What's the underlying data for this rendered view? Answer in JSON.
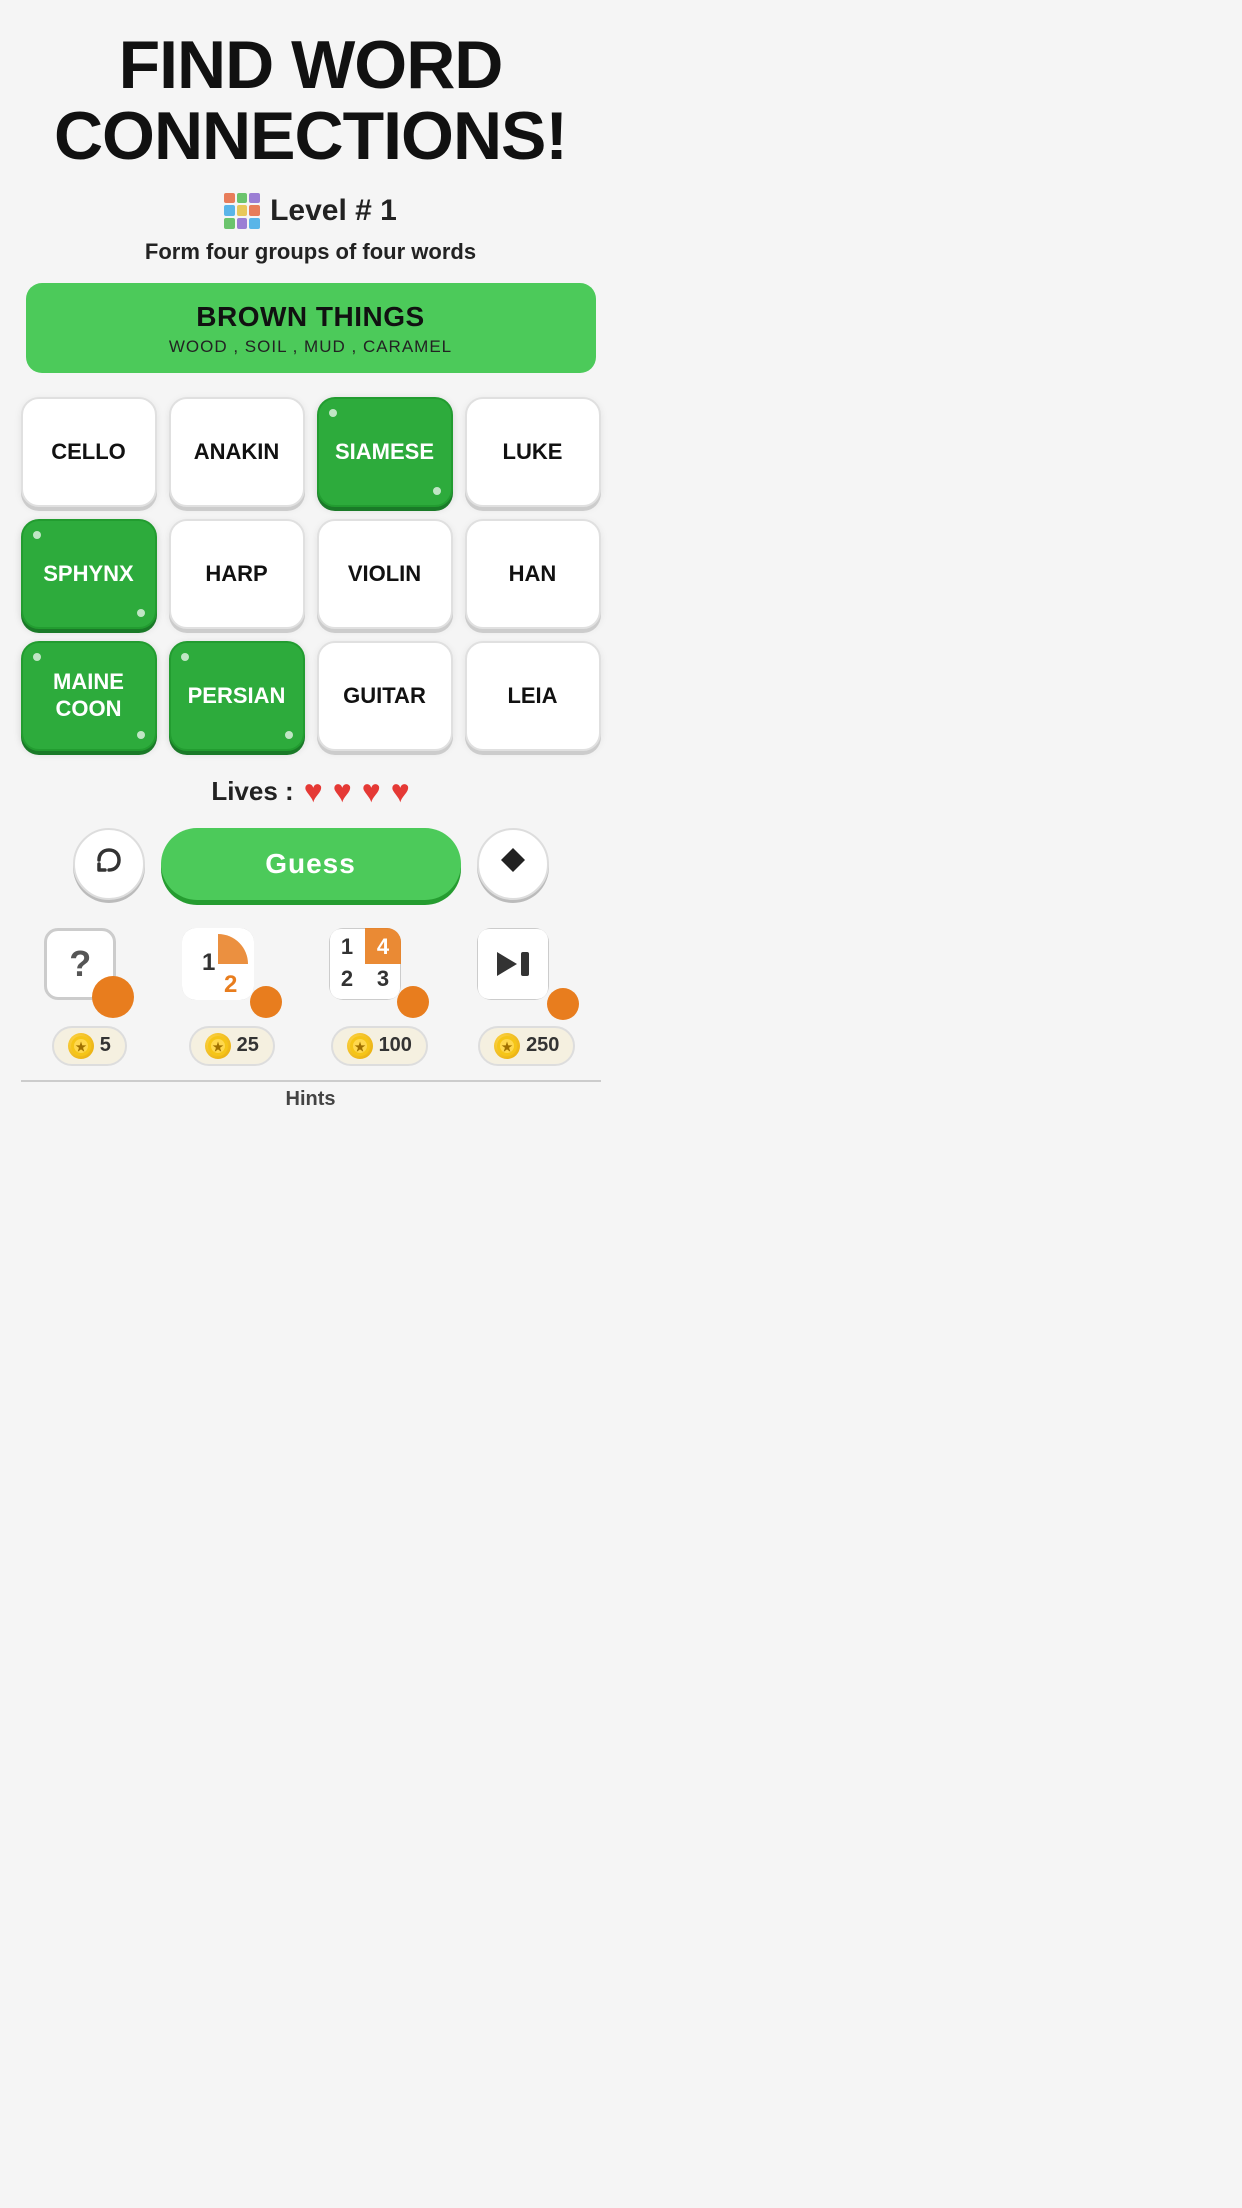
{
  "title": "FIND WORD CONNECTIONS!",
  "level": {
    "label": "Level # 1"
  },
  "subtitle": "Form four groups of four words",
  "banner": {
    "title": "BROWN THINGS",
    "sub": "WOOD , SOIL , MUD , CARAMEL"
  },
  "tiles": [
    {
      "id": 0,
      "word": "CELLO",
      "selected": false
    },
    {
      "id": 1,
      "word": "ANAKIN",
      "selected": false
    },
    {
      "id": 2,
      "word": "SIAMESE",
      "selected": true
    },
    {
      "id": 3,
      "word": "LUKE",
      "selected": false
    },
    {
      "id": 4,
      "word": "SPHYNX",
      "selected": true
    },
    {
      "id": 5,
      "word": "HARP",
      "selected": false
    },
    {
      "id": 6,
      "word": "VIOLIN",
      "selected": false
    },
    {
      "id": 7,
      "word": "HAN",
      "selected": false
    },
    {
      "id": 8,
      "word": "MAINE\nCOON",
      "selected": true
    },
    {
      "id": 9,
      "word": "PERSIAN",
      "selected": true
    },
    {
      "id": 10,
      "word": "GUITAR",
      "selected": false
    },
    {
      "id": 11,
      "word": "LEIA",
      "selected": false
    }
  ],
  "lives": {
    "label": "Lives :",
    "count": 4
  },
  "buttons": {
    "shuffle": "↺",
    "guess": "Guess",
    "erase": "◆"
  },
  "hints": [
    {
      "id": "hint1",
      "icon": "?",
      "cost_icon": "⭐",
      "cost": "5"
    },
    {
      "id": "hint2",
      "nums": [
        "1",
        "2"
      ],
      "cost": "25"
    },
    {
      "id": "hint3",
      "nums": [
        "1",
        "4",
        "2",
        "3"
      ],
      "cost": "100"
    },
    {
      "id": "hint4",
      "cost": "250"
    }
  ],
  "hints_label": "Hints"
}
